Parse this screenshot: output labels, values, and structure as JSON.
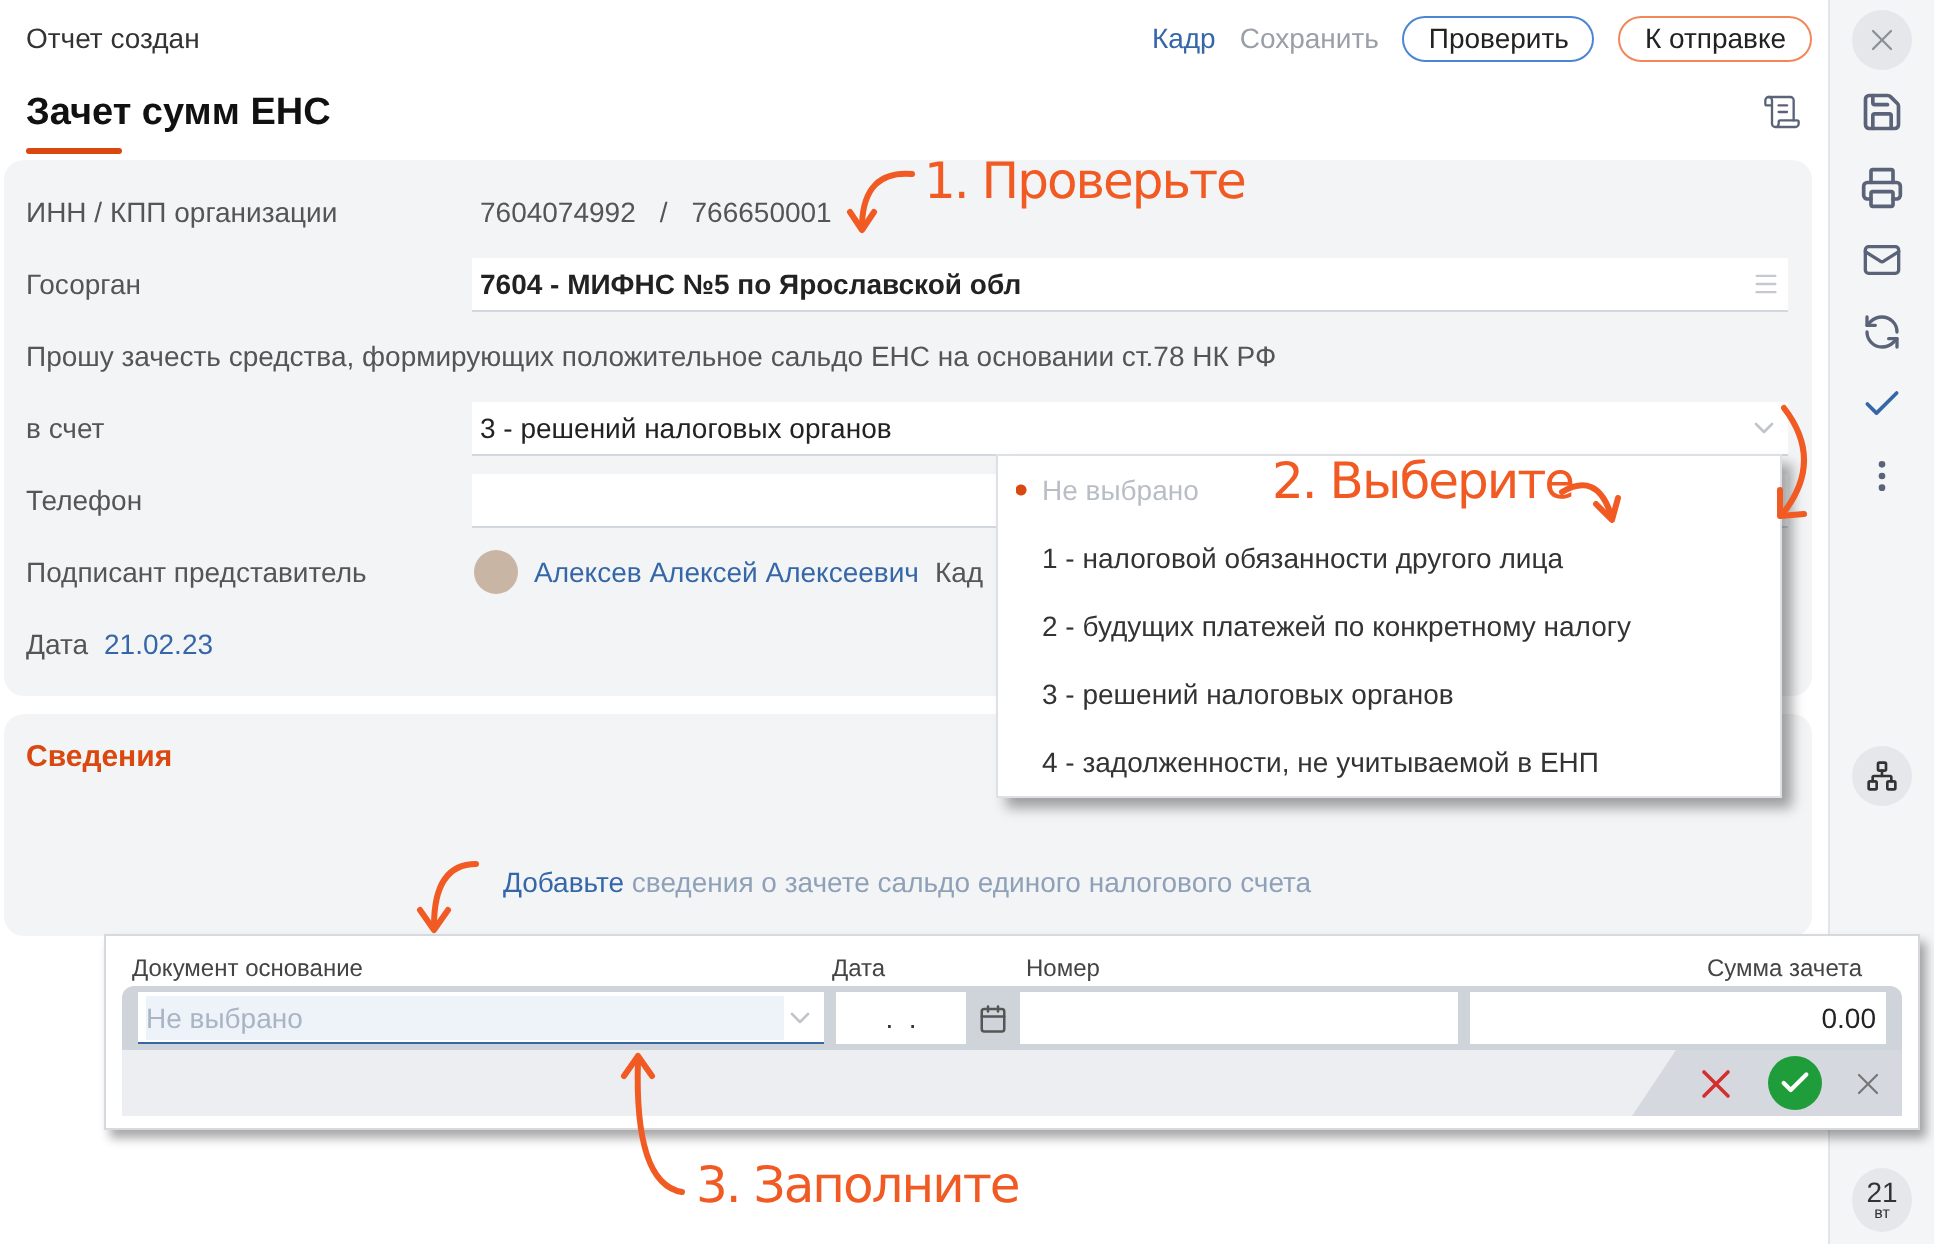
{
  "header": {
    "status": "Отчет создан",
    "links": [
      {
        "label": "Кадр",
        "disabled": false
      },
      {
        "label": "Сохранить",
        "disabled": true
      }
    ],
    "buttons": [
      {
        "label": "Проверить",
        "kind": "check"
      },
      {
        "label": "К отправке",
        "kind": "send"
      }
    ]
  },
  "title": "Зачет сумм ЕНС",
  "form": {
    "rows": [
      {
        "kind": "inn",
        "label": "ИНН / КПП организации",
        "values": [
          "7604074992",
          "/",
          "766650001"
        ]
      },
      {
        "kind": "field",
        "label": "Госорган",
        "value": "7604 - МИФНС №5 по Ярославской обл"
      },
      {
        "kind": "note",
        "text": "Прошу зачесть средства, формирующих положительное сальдо ЕНС на основании ст.78 НК РФ"
      },
      {
        "kind": "select",
        "label": "в счет",
        "value": "3 - решений налоговых органов"
      },
      {
        "kind": "input",
        "label": "Телефон"
      },
      {
        "kind": "person",
        "label": "Подписант представитель",
        "name": "Алексев Алексей Алексеевич",
        "role": "Кад"
      },
      {
        "kind": "date",
        "label": "Дата",
        "value": "21.02.23"
      }
    ]
  },
  "section": {
    "title": "Сведения",
    "hint_link": "Добавьте",
    "hint": "сведения о зачете сальдо единого налогового счета"
  },
  "dropdown": {
    "options": [
      {
        "label": "Не выбрано",
        "kind": "empty",
        "selected": true
      },
      {
        "label": "1 - налоговой обязанности другого лица",
        "kind": "option",
        "selected": false
      },
      {
        "label": "2 - будущих платежей по конкретному налогу",
        "kind": "option",
        "selected": false
      },
      {
        "label": "3 - решений налоговых органов",
        "kind": "option",
        "selected": false
      },
      {
        "label": "4 - задолженности, не учитываемой в ЕНП",
        "kind": "option",
        "selected": false
      }
    ]
  },
  "editor": {
    "columns": [
      "Документ основание",
      "Дата",
      "Номер",
      "Сумма зачета"
    ],
    "document": {
      "placeholder": "Не выбрано"
    },
    "date": ".  .",
    "sum": "0.00"
  },
  "sidebar": {
    "date_badge": {
      "day": "21",
      "weekday": "вт"
    }
  },
  "annotations": [
    {
      "text": "1. Проверьте"
    },
    {
      "text": "2. Выберите"
    },
    {
      "text": "3. Заполните"
    }
  ]
}
